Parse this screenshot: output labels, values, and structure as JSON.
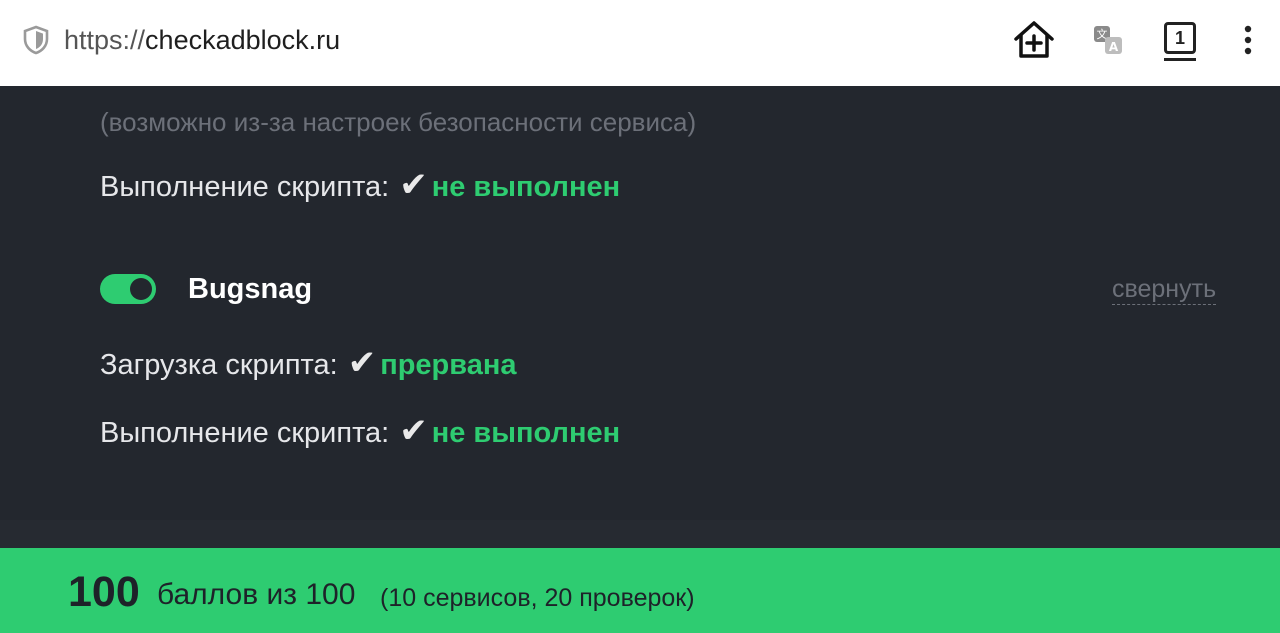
{
  "browser": {
    "url_scheme": "https://",
    "url_host": "checkadblock.ru",
    "tab_count": "1",
    "icons": [
      "shield-icon",
      "home-add-icon",
      "translate-icon",
      "tabs-icon",
      "more-vert-icon"
    ]
  },
  "content": {
    "note": "(возможно из-за настроек безопасности сервиса)",
    "prev_service": {
      "exec_label": "Выполнение скрипта:",
      "check": "✔",
      "exec_status": "не выполнен"
    },
    "service": {
      "name": "Bugsnag",
      "enabled": true,
      "collapse_label": "свернуть",
      "load_label": "Загрузка скрипта:",
      "load_check": "✔",
      "load_status": "прервана",
      "exec_label": "Выполнение скрипта:",
      "exec_check": "✔",
      "exec_status": "не выполнен"
    }
  },
  "footer": {
    "score": "100",
    "score_text": "баллов из 100",
    "detail": "(10 сервисов, 20 проверок)"
  },
  "colors": {
    "accent": "#2ecc71",
    "background": "#23272e",
    "muted": "#6c7079"
  }
}
